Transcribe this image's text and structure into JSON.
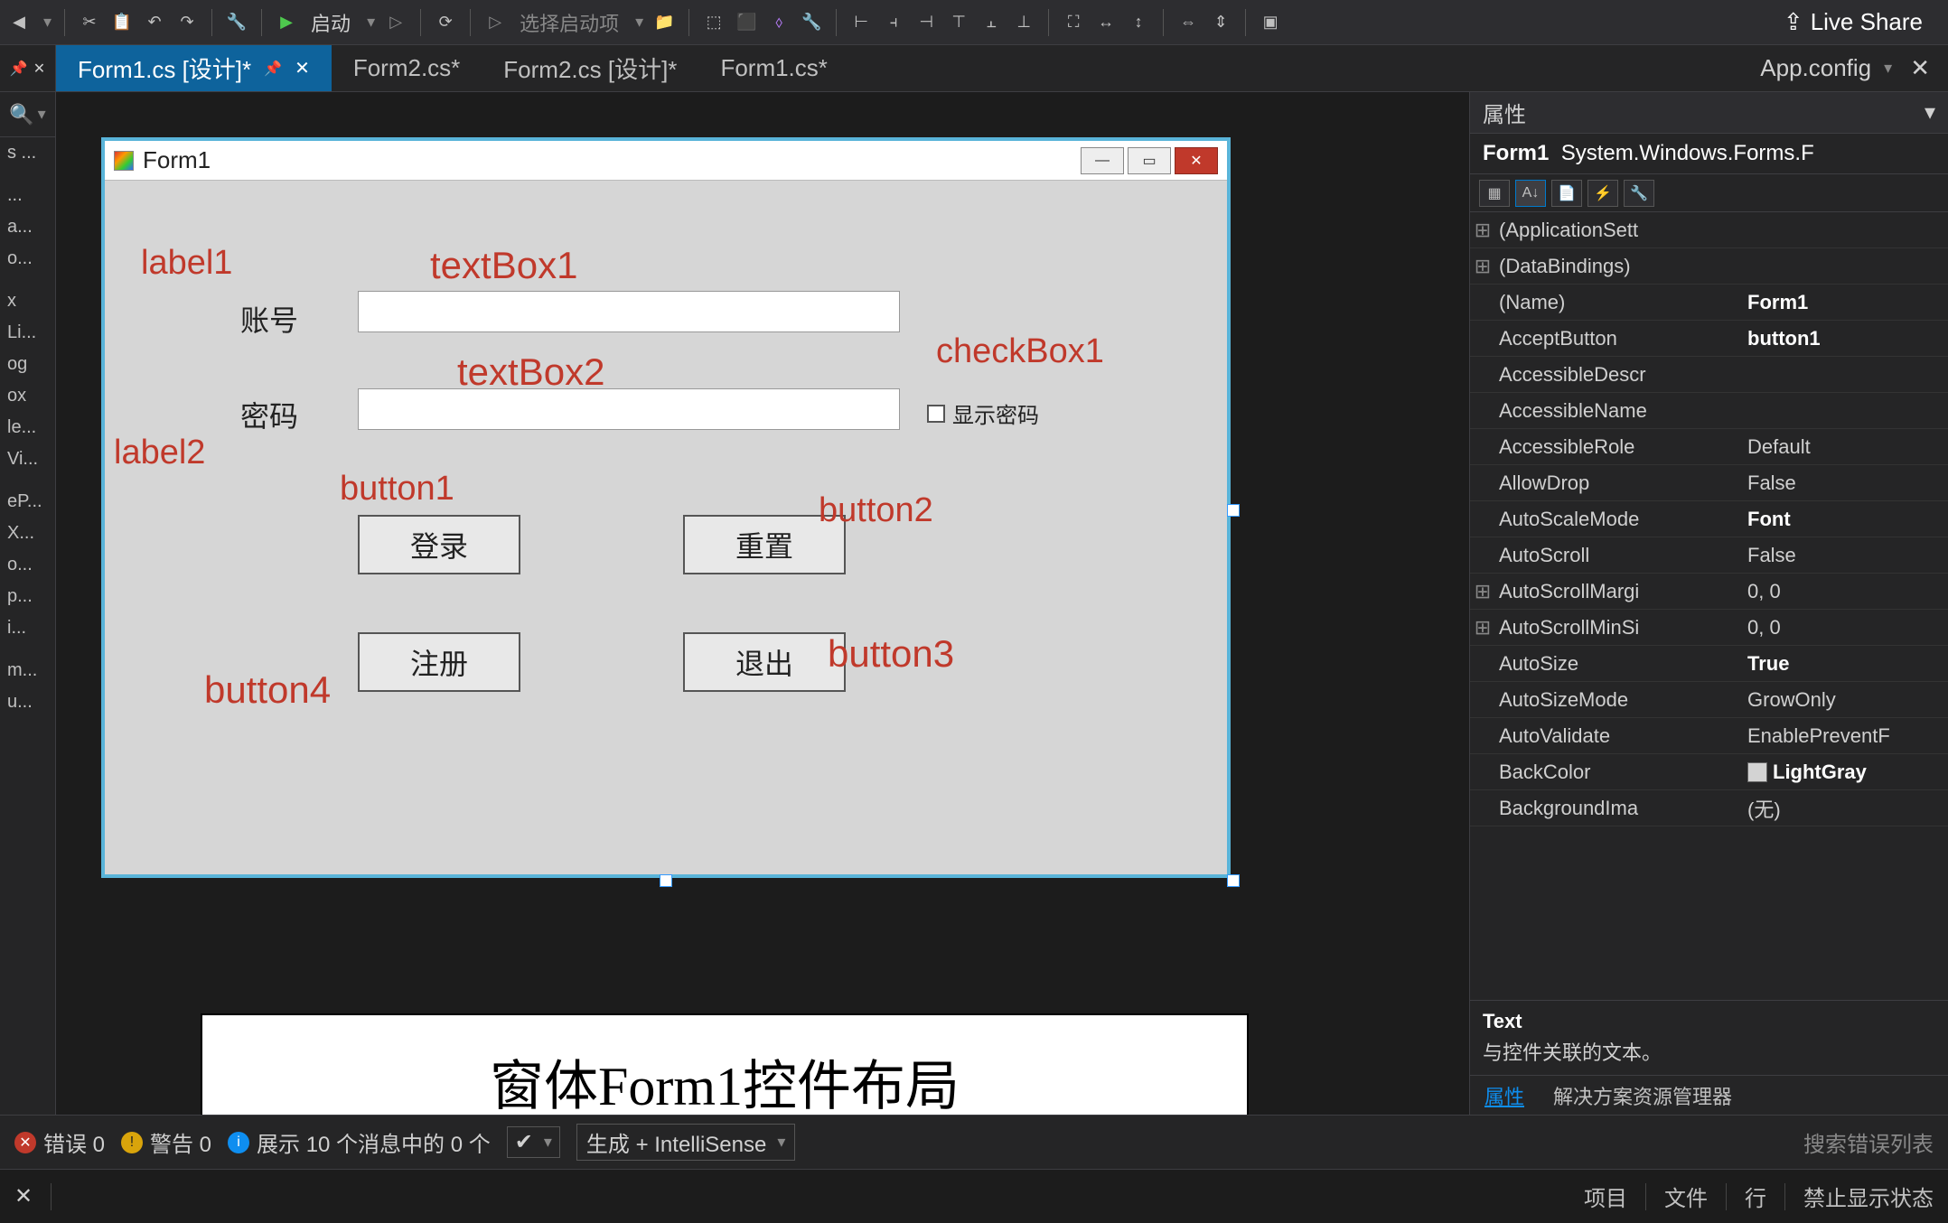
{
  "toolbar": {
    "launch": "启动",
    "launch_item": "选择启动项",
    "live_share": "Live Share"
  },
  "tabs": {
    "active": "Form1.cs [设计]*",
    "t2": "Form2.cs*",
    "t3": "Form2.cs [设计]*",
    "t4": "Form1.cs*",
    "right": "App.config"
  },
  "gutter": [
    "s ...",
    " ",
    "...",
    "a...",
    "o...",
    " ",
    "x",
    "Li...",
    "og",
    "ox",
    "le...",
    "Vi...",
    " ",
    "eP...",
    "X...",
    "o...",
    "p...",
    "i...",
    " ",
    "m...",
    "u..."
  ],
  "form": {
    "title": "Form1",
    "label1_text": "账号",
    "label2_text": "密码",
    "checkbox1_text": "显示密码",
    "button1_text": "登录",
    "button2_text": "重置",
    "button3_text": "退出",
    "button4_text": "注册"
  },
  "annotations": {
    "label1": "label1",
    "label2": "label2",
    "textBox1": "textBox1",
    "textBox2": "textBox2",
    "checkBox1": "checkBox1",
    "button1": "button1",
    "button2": "button2",
    "button3": "button3",
    "button4": "button4"
  },
  "caption": "窗体Form1控件布局",
  "props": {
    "panel_title": "属性",
    "object": "Form1  System.Windows.Forms.F",
    "rows": [
      {
        "exp": "⊞",
        "k": "(ApplicationSett",
        "v": ""
      },
      {
        "exp": "⊞",
        "k": "(DataBindings)",
        "v": ""
      },
      {
        "exp": "",
        "k": "(Name)",
        "v": "Form1",
        "bold": true
      },
      {
        "exp": "",
        "k": "AcceptButton",
        "v": "button1",
        "bold": true
      },
      {
        "exp": "",
        "k": "AccessibleDescr",
        "v": ""
      },
      {
        "exp": "",
        "k": "AccessibleName",
        "v": ""
      },
      {
        "exp": "",
        "k": "AccessibleRole",
        "v": "Default"
      },
      {
        "exp": "",
        "k": "AllowDrop",
        "v": "False"
      },
      {
        "exp": "",
        "k": "AutoScaleMode",
        "v": "Font",
        "bold": true
      },
      {
        "exp": "",
        "k": "AutoScroll",
        "v": "False"
      },
      {
        "exp": "⊞",
        "k": "AutoScrollMargi",
        "v": "0, 0"
      },
      {
        "exp": "⊞",
        "k": "AutoScrollMinSi",
        "v": "0, 0"
      },
      {
        "exp": "",
        "k": "AutoSize",
        "v": "True",
        "bold": true
      },
      {
        "exp": "",
        "k": "AutoSizeMode",
        "v": "GrowOnly"
      },
      {
        "exp": "",
        "k": "AutoValidate",
        "v": "EnablePreventF"
      },
      {
        "exp": "",
        "k": "BackColor",
        "v": "LightGray",
        "swatch": true,
        "bold": true
      },
      {
        "exp": "",
        "k": "BackgroundIma",
        "v": "(无)"
      }
    ],
    "desc_title": "Text",
    "desc_body": "与控件关联的文本。",
    "tab1": "属性",
    "tab2": "解决方案资源管理器"
  },
  "errorbar": {
    "errors": "错误 0",
    "warnings": "警告 0",
    "info": "展示 10 个消息中的 0 个",
    "dropdown": "生成 + IntelliSense",
    "search": "搜索错误列表"
  },
  "statusbar": {
    "project": "项目",
    "file": "文件",
    "line": "行",
    "suppress": "禁止显示状态"
  }
}
